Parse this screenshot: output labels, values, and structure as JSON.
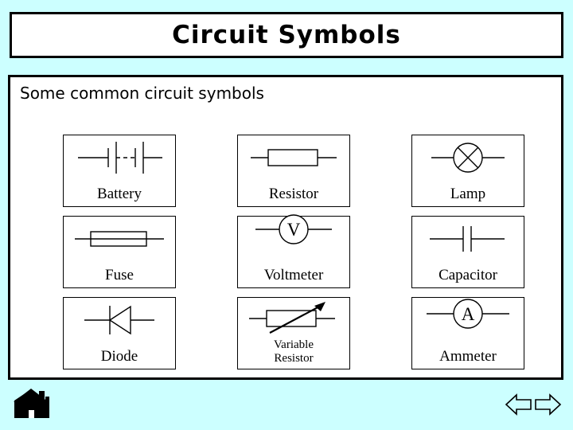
{
  "slide": {
    "title": "Circuit Symbols",
    "subtitle": "Some common circuit symbols",
    "background_color": "#CCFFFF",
    "panel_color": "#FFFFFF",
    "line_color": "#000000"
  },
  "symbols": [
    [
      {
        "label": "Battery",
        "icon": "battery-symbol",
        "lines": 1
      },
      {
        "label": "Resistor",
        "icon": "resistor-symbol",
        "lines": 1
      },
      {
        "label": "Lamp",
        "icon": "lamp-symbol",
        "lines": 1
      }
    ],
    [
      {
        "label": "Fuse",
        "icon": "fuse-symbol",
        "lines": 1
      },
      {
        "label": "Voltmeter",
        "icon": "voltmeter-symbol",
        "lines": 1,
        "meter_letter": "V"
      },
      {
        "label": "Capacitor",
        "icon": "capacitor-symbol",
        "lines": 1
      }
    ],
    [
      {
        "label": "Diode",
        "icon": "diode-symbol",
        "lines": 1
      },
      {
        "label": "Variable",
        "label2": "Resistor",
        "icon": "variable-resistor-symbol",
        "lines": 2
      },
      {
        "label": "Ammeter",
        "icon": "ammeter-symbol",
        "lines": 1,
        "meter_letter": "A"
      }
    ]
  ],
  "navigation": {
    "home": "home-icon",
    "back": "back-arrow-icon",
    "forward": "forward-arrow-icon"
  }
}
